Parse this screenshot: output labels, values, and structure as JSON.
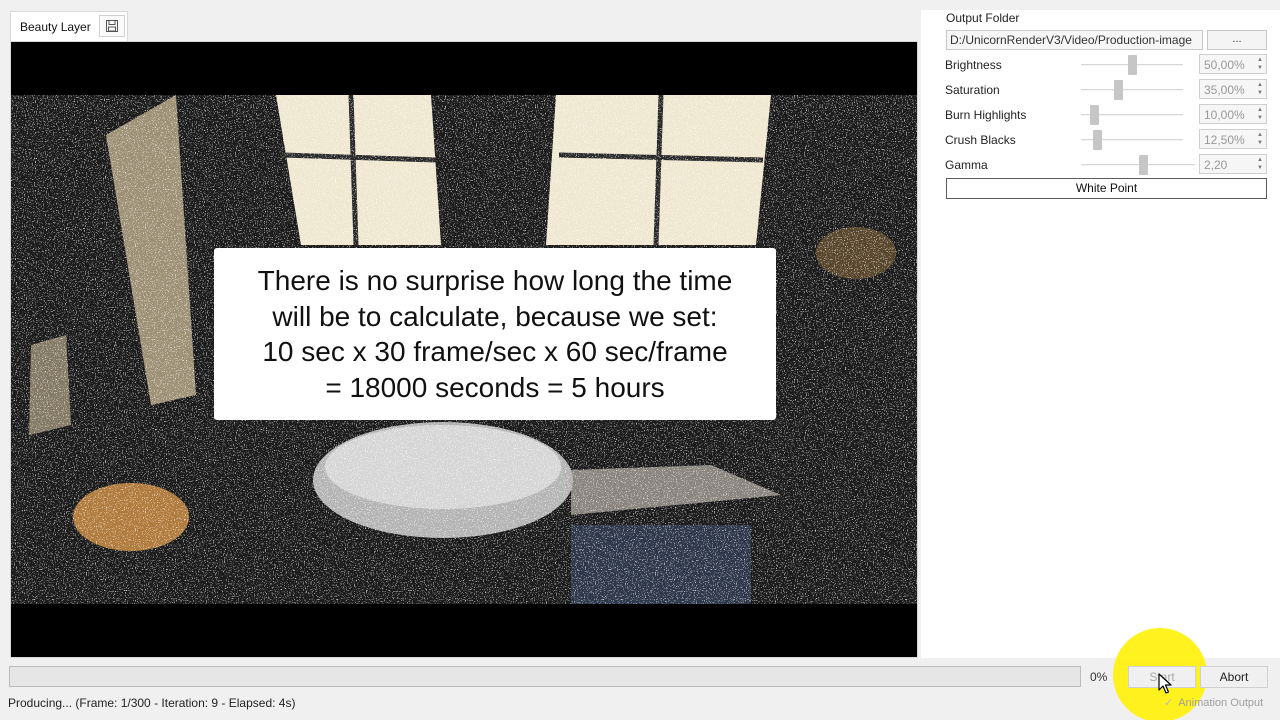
{
  "viewport": {
    "tab_label": "Beauty Layer",
    "tab_icon": "save-icon",
    "caption": "There is no surprise how long the time\nwill be to calculate, because we set:\n10 sec x 30 frame/sec x 60 sec/frame\n= 18000 seconds = 5 hours"
  },
  "settings": {
    "output_folder_label": "Output Folder",
    "output_folder_value": "D:/UnicornRenderV3/Video/Production-image",
    "browse_label": "...",
    "sliders": [
      {
        "label": "Brightness",
        "value": "50,00%",
        "level": 0.5
      },
      {
        "label": "Saturation",
        "value": "35,00%",
        "level": 0.35
      },
      {
        "label": "Burn Highlights",
        "value": "10,00%",
        "level": 0.1
      },
      {
        "label": "Crush Blacks",
        "value": "12,50%",
        "level": 0.125
      },
      {
        "label": "Gamma",
        "value": "2,20",
        "level": 0.55
      }
    ],
    "white_point_label": "White Point"
  },
  "render": {
    "progress_percent_text": "0%",
    "progress_fraction": 0,
    "start_label": "Start",
    "abort_label": "Abort",
    "status_text": "Producing... (Frame: 1/300 - Iteration: 9 - Elapsed: 4s)",
    "animation_output_label": "Animation Output",
    "animation_output_checked": true
  },
  "colors": {
    "highlight": "#fff000",
    "panel_bg": "#ffffff",
    "window_bg": "#f0f0f0"
  }
}
